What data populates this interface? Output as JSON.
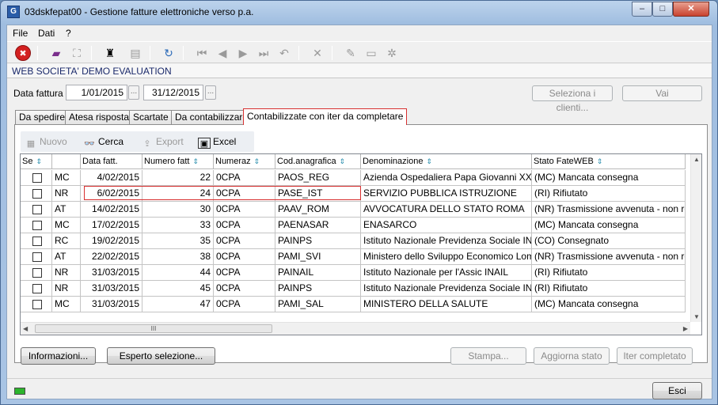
{
  "window": {
    "title": "03dskfepat00 - Gestione fatture elettroniche verso p.a.",
    "app_icon": "G",
    "min_glyph": "–",
    "max_glyph": "□",
    "close_glyph": "✕"
  },
  "menu": [
    "File",
    "Dati",
    "?"
  ],
  "company": "WEB SOCIETA'  DEMO EVALUATION",
  "filter": {
    "label": "Data fattura",
    "from": "1/01/2015",
    "to": "31/12/2015",
    "dots": "...",
    "select_clients": "Seleziona i clienti...",
    "go": "Vai"
  },
  "tabs": [
    "Da spedire",
    "Atesa risposta",
    "Scartate",
    "Da contabilizzare",
    "Contabilizzate con iter da completare"
  ],
  "active_tab": 4,
  "subtoolbar": {
    "new": "Nuovo",
    "search": "Cerca",
    "export": "Export",
    "excel": "Excel"
  },
  "grid": {
    "columns": [
      "Se",
      "",
      "Data fatt.",
      "Numero fatt",
      "Numeraz",
      "Cod.anagrafica",
      "Denominazione",
      "Stato FateWEB"
    ],
    "rows": [
      {
        "code": "MC",
        "date": "4/02/2015",
        "number": "22",
        "series": "0CPA",
        "cod": "PAOS_REG",
        "name": "Azienda Ospedaliera Papa Giovanni XXIII",
        "status": "(MC) Mancata consegna"
      },
      {
        "code": "NR",
        "date": "6/02/2015",
        "number": "24",
        "series": "0CPA",
        "cod": "PASE_IST",
        "name": "SERVIZIO PUBBLICA ISTRUZIONE",
        "status": "(RI) Rifiutato"
      },
      {
        "code": "AT",
        "date": "14/02/2015",
        "number": "30",
        "series": "0CPA",
        "cod": "PAAV_ROM",
        "name": "AVVOCATURA DELLO STATO ROMA",
        "status": "(NR) Trasmissione avvenuta - non recap"
      },
      {
        "code": "MC",
        "date": "17/02/2015",
        "number": "33",
        "series": "0CPA",
        "cod": "PAENASAR",
        "name": "ENASARCO",
        "status": "(MC) Mancata consegna"
      },
      {
        "code": "RC",
        "date": "19/02/2015",
        "number": "35",
        "series": "0CPA",
        "cod": "PAINPS",
        "name": "Istituto Nazionale Previdenza Sociale INPS",
        "status": "(CO) Consegnato"
      },
      {
        "code": "AT",
        "date": "22/02/2015",
        "number": "38",
        "series": "0CPA",
        "cod": "PAMI_SVI",
        "name": "Ministero dello Sviluppo Economico Lombard",
        "status": "(NR) Trasmissione avvenuta - non recap"
      },
      {
        "code": "NR",
        "date": "31/03/2015",
        "number": "44",
        "series": "0CPA",
        "cod": "PAINAIL",
        "name": "Istituto Nazionale per l'Assic INAIL",
        "status": "(RI) Rifiutato"
      },
      {
        "code": "NR",
        "date": "31/03/2015",
        "number": "45",
        "series": "0CPA",
        "cod": "PAINPS",
        "name": "Istituto Nazionale Previdenza Sociale INPS",
        "status": "(RI) Rifiutato"
      },
      {
        "code": "MC",
        "date": "31/03/2015",
        "number": "47",
        "series": "0CPA",
        "cod": "PAMI_SAL",
        "name": "MINISTERO DELLA SALUTE",
        "status": "(MC) Mancata consegna"
      }
    ],
    "scroll_thumb": "III",
    "arrows": {
      "up": "▲",
      "down": "▼",
      "left": "◀",
      "right": "▶"
    }
  },
  "buttons": {
    "info": "Informazioni...",
    "expert": "Esperto selezione...",
    "print": "Stampa...",
    "update": "Aggiorna stato",
    "iter": "Iter completato"
  },
  "exit": "Esci",
  "icons": {
    "close": "✖",
    "book": "▰",
    "binoculars": "⛶",
    "find": "♜",
    "stack": "▤",
    "refresh": "↻",
    "first": "⏮",
    "prev": "◀",
    "next": "▶",
    "last": "⏭",
    "undo": "↶",
    "delete": "✕",
    "edit": "✎",
    "folder": "▭",
    "tree": "✲",
    "new_sub": "▦",
    "cerca": "👓",
    "export_sub": "⇪",
    "excel_sub": "▣",
    "sort": "⇕"
  },
  "colors": {
    "active_tab_border": "#d83030",
    "status_led": "#2db52d",
    "title_bar": "#a9c4e4"
  }
}
